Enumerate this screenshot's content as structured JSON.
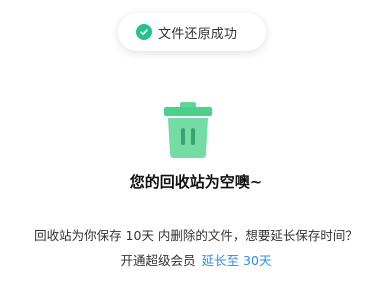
{
  "toast": {
    "message": "文件还原成功",
    "icon": "check-circle-icon",
    "accent_color": "#25c289"
  },
  "empty_state": {
    "icon": "trash-can-icon",
    "icon_color": "#4cd18c",
    "title": "您的回收站为空噢~",
    "description": "回收站为你保存 10天 内删除的文件，想要延长保存时间？",
    "promo_prefix": "开通超级会员",
    "promo_link": "延长至 30天",
    "link_color": "#2d8cf0"
  }
}
